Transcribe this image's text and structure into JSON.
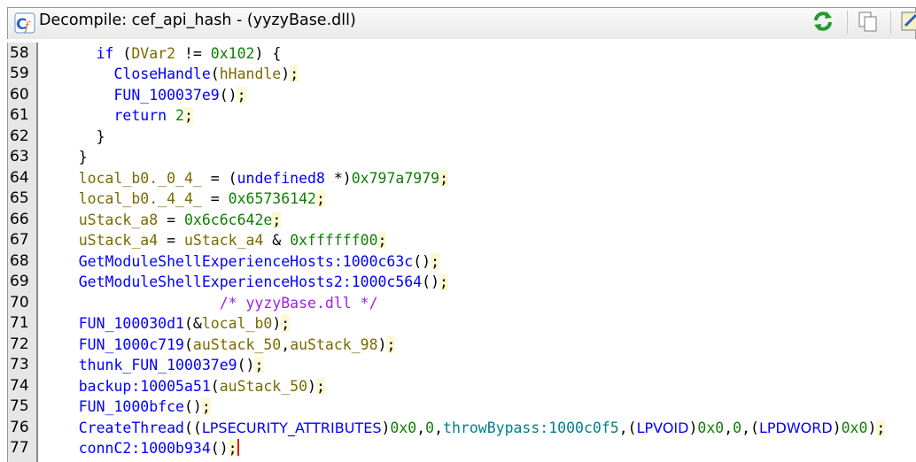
{
  "window": {
    "title": "Decompile: cef_api_hash - (yyzyBase.dll)",
    "icons": [
      "decompile-app-icon",
      "refresh-icon",
      "copy-icon",
      "snapshot-icon"
    ]
  },
  "line_numbers": [
    "58",
    "59",
    "60",
    "61",
    "62",
    "63",
    "64",
    "65",
    "66",
    "67",
    "68",
    "69",
    "70",
    "71",
    "72",
    "73",
    "74",
    "75",
    "76",
    "77"
  ],
  "code": {
    "l58_a": "if",
    "l58_b": "DVar2",
    "l58_c": "0x102",
    "l59_a": "CloseHandle",
    "l59_b": "hHandle",
    "l60_a": "FUN_100037e9",
    "l61_a": "return",
    "l61_b": "2",
    "l64_a": "local_b0._0_4_",
    "l64_b": "undefined8",
    "l64_c": "0x797a7979",
    "l65_a": "local_b0._4_4_",
    "l65_b": "0x65736142",
    "l66_a": "uStack_a8",
    "l66_b": "0x6c6c642e",
    "l67_a": "uStack_a4",
    "l67_b": "uStack_a4",
    "l67_c": "0xffffff00",
    "l68_a": "GetModuleShellExperienceHosts:1000c63c",
    "l69_a": "GetModuleShellExperienceHosts2:1000c564",
    "l70_a": "/* yyzyBase.dll */",
    "l71_a": "FUN_100030d1",
    "l71_b": "local_b0",
    "l72_a": "FUN_1000c719",
    "l72_b": "auStack_50",
    "l72_c": "auStack_98",
    "l73_a": "thunk_FUN_100037e9",
    "l74_a": "backup:10005a51",
    "l74_b": "auStack_50",
    "l75_a": "FUN_1000bfce",
    "l76_a": "CreateThread",
    "l76_b": "LPSECURITY_ATTRIBUTES",
    "l76_c": "0x0",
    "l76_d": "0",
    "l76_e": "throwBypass:1000c0f5",
    "l76_f": "LPVOID",
    "l76_g": "0x0",
    "l76_h": "0",
    "l76_i": "LPDWORD",
    "l76_j": "0x0",
    "l77_a": "connC2:1000b934"
  }
}
